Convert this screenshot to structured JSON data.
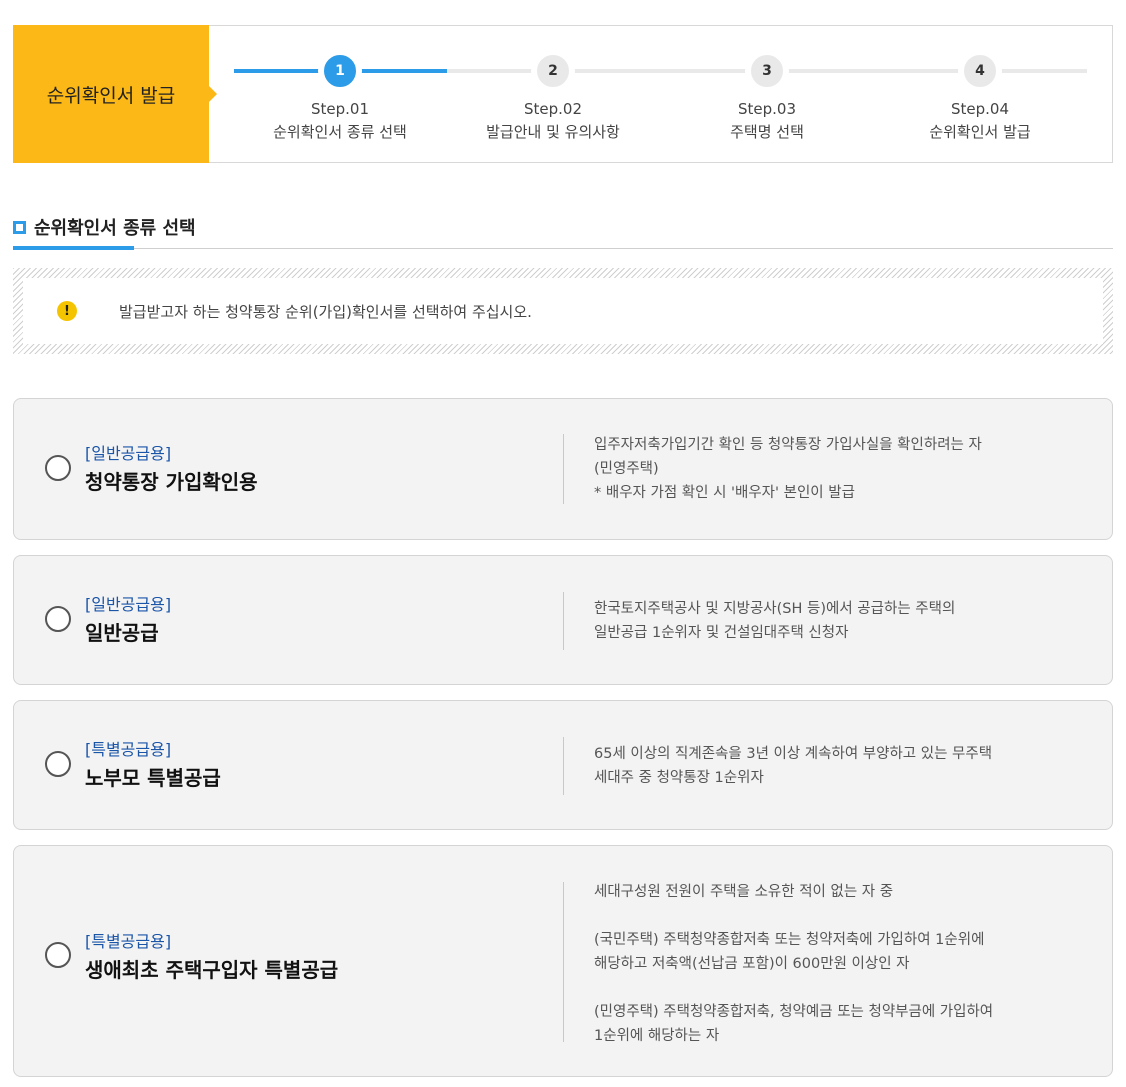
{
  "header": {
    "title": "순위확인서 발급",
    "steps": [
      {
        "num": "1",
        "step": "Step.01",
        "label": "순위확인서 종류 선택"
      },
      {
        "num": "2",
        "step": "Step.02",
        "label": "발급안내 및 유의사항"
      },
      {
        "num": "3",
        "step": "Step.03",
        "label": "주택명 선택"
      },
      {
        "num": "4",
        "step": "Step.04",
        "label": "순위확인서 발급"
      }
    ],
    "active_step": 1
  },
  "section": {
    "title": "순위확인서 종류 선택"
  },
  "notice": {
    "icon": "exclamation-icon",
    "text": "발급받고자 하는 청약통장 순위(가입)확인서를 선택하여 주십시오."
  },
  "options": [
    {
      "tag": "[일반공급용]",
      "name": "청약통장 가입확인용",
      "desc": [
        "입주자저축가입기간 확인 등 청약통장 가입사실을 확인하려는 자",
        "(민영주택)",
        "* 배우자 가점 확인 시 '배우자' 본인이 발급"
      ]
    },
    {
      "tag": "[일반공급용]",
      "name": "일반공급",
      "desc": [
        "한국토지주택공사 및 지방공사(SH 등)에서 공급하는 주택의",
        "일반공급 1순위자 및 건설임대주택 신청자"
      ]
    },
    {
      "tag": "[특별공급용]",
      "name": "노부모 특별공급",
      "desc": [
        "65세 이상의 직계존속을 3년 이상 계속하여 부양하고 있는 무주택",
        "세대주 중 청약통장 1순위자"
      ]
    },
    {
      "tag": "[특별공급용]",
      "name": "생애최초 주택구입자 특별공급",
      "desc": [
        "세대구성원 전원이 주택을 소유한 적이 없는 자 중",
        "(국민주택) 주택청약종합저축 또는 청약저축에 가입하여 1순위에",
        "해당하고 저축액(선납금 포함)이 600만원 이상인 자",
        "(민영주택) 주택청약종합저축, 청약예금 또는 청약부금에 가입하여",
        "1순위에 해당하는 자"
      ]
    }
  ],
  "colors": {
    "accent": "#2c9be8",
    "header_bg": "#fbb817",
    "tag": "#1a55a8",
    "warn": "#f5c400"
  }
}
